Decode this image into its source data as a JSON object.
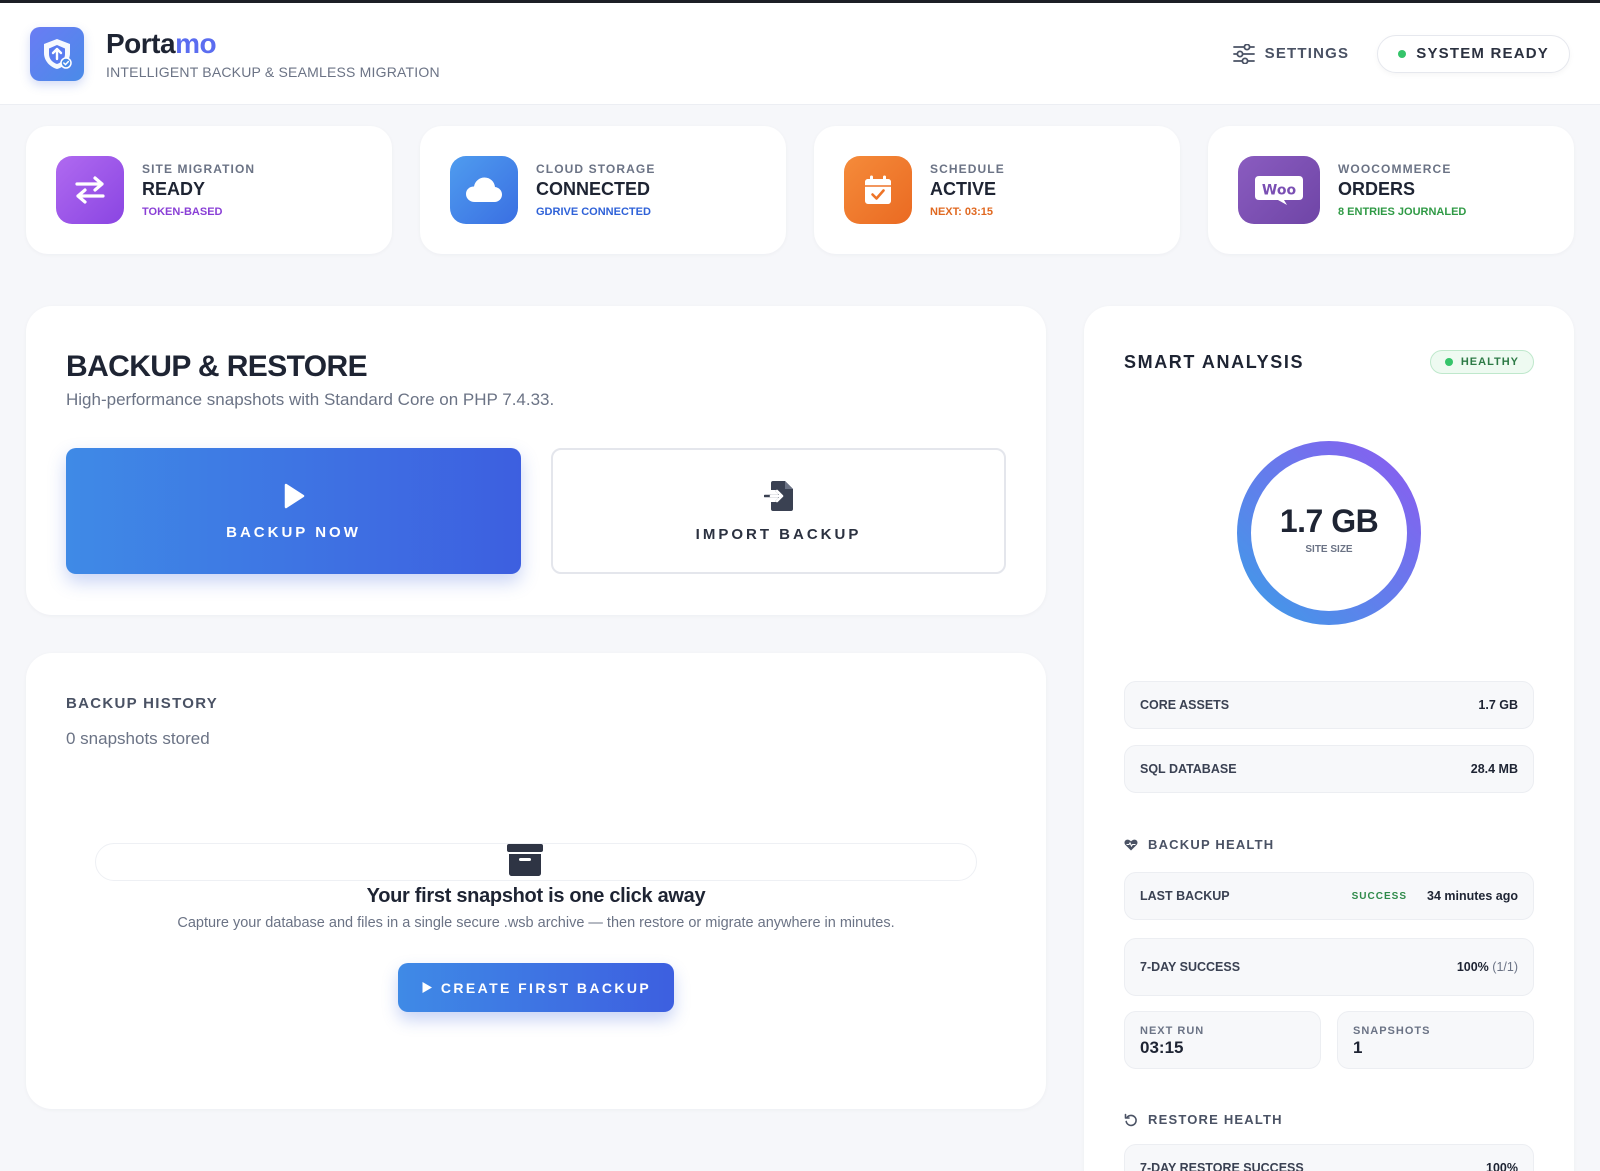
{
  "header": {
    "brand_main": "Porta",
    "brand_accent": "mo",
    "tagline": "INTELLIGENT BACKUP & SEAMLESS MIGRATION",
    "settings_label": "SETTINGS",
    "status_label": "SYSTEM READY"
  },
  "cards": [
    {
      "kicker": "SITE MIGRATION",
      "title": "READY",
      "sub": "TOKEN-BASED",
      "icon": "swap-arrows-icon",
      "color": "#9b4fe8",
      "sub_color": "#8a3fd6"
    },
    {
      "kicker": "CLOUD STORAGE",
      "title": "CONNECTED",
      "sub": "GDRIVE CONNECTED",
      "icon": "cloud-icon",
      "color": "#3f88e6",
      "sub_color": "#2f62d8"
    },
    {
      "kicker": "SCHEDULE",
      "title": "ACTIVE",
      "sub": "NEXT: 03:15",
      "icon": "calendar-check-icon",
      "color": "#f07a2c",
      "sub_color": "#e06820"
    },
    {
      "kicker": "WOOCOMMERCE",
      "title": "ORDERS",
      "sub": "8 ENTRIES JOURNALED",
      "icon": "woo-icon",
      "color": "#7e52b0",
      "sub_color": "#2f9a45"
    }
  ],
  "backup": {
    "title": "BACKUP & RESTORE",
    "subtitle": "High-performance snapshots with Standard Core on PHP 7.4.33.",
    "backup_now_label": "BACKUP NOW",
    "import_label": "IMPORT BACKUP"
  },
  "history": {
    "title": "BACKUP HISTORY",
    "count_text": "0 snapshots stored",
    "empty_title": "Your first snapshot is one click away",
    "empty_desc": "Capture your database and files in a single secure .wsb archive — then restore or migrate anywhere in minutes.",
    "create_label": "CREATE FIRST BACKUP"
  },
  "analysis": {
    "title": "SMART ANALYSIS",
    "status": "HEALTHY",
    "site_size_value": "1.7 GB",
    "site_size_label": "SITE SIZE",
    "core_assets_label": "CORE ASSETS",
    "core_assets_value": "1.7 GB",
    "sql_label": "SQL DATABASE",
    "sql_value": "28.4 MB",
    "backup_health_title": "BACKUP HEALTH",
    "last_backup_label": "LAST BACKUP",
    "last_backup_status": "SUCCESS",
    "last_backup_time": "34 minutes ago",
    "seven_day_label": "7-DAY SUCCESS",
    "seven_day_value": "100%",
    "seven_day_detail": "(1/1)",
    "next_run_label": "NEXT RUN",
    "next_run_value": "03:15",
    "snapshots_label": "SNAPSHOTS",
    "snapshots_value": "1",
    "restore_health_title": "RESTORE HEALTH",
    "restore_success_label": "7-DAY RESTORE SUCCESS",
    "restore_success_value": "100%"
  }
}
